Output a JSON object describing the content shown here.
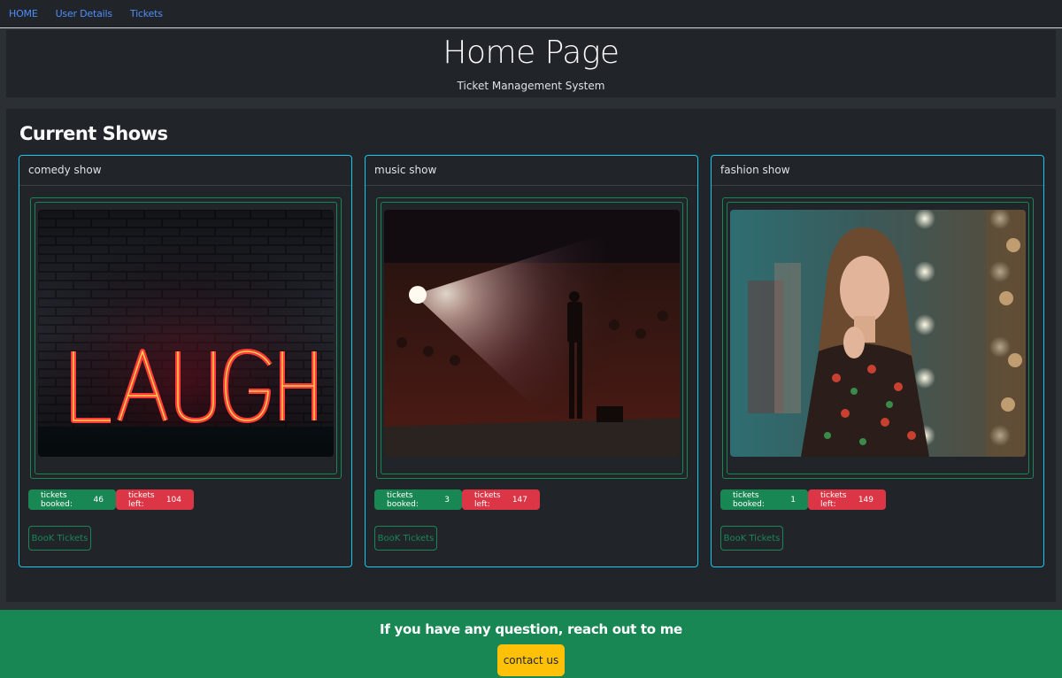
{
  "nav": {
    "items": [
      {
        "label": "HOME"
      },
      {
        "label": "User Details"
      },
      {
        "label": "Tickets"
      }
    ]
  },
  "header": {
    "title": "Home Page",
    "subtitle": "Ticket Management System"
  },
  "main": {
    "section_title": "Current Shows",
    "shows": [
      {
        "name": "comedy show",
        "booked_label": "tickets booked:",
        "booked": "46",
        "left_label": "tickets left:",
        "left": "104",
        "button": "BooK Tickets",
        "image": "laugh-neon-sign"
      },
      {
        "name": "music show",
        "booked_label": "tickets booked:",
        "booked": "3",
        "left_label": "tickets left:",
        "left": "147",
        "button": "BooK Tickets",
        "image": "concert-stage-spotlight"
      },
      {
        "name": "fashion show",
        "booked_label": "tickets booked:",
        "booked": "1",
        "left_label": "tickets left:",
        "left": "149",
        "button": "BooK Tickets",
        "image": "woman-portrait"
      }
    ]
  },
  "footer": {
    "text": "If you have any question, reach out to me",
    "button": "contact us"
  },
  "colors": {
    "background": "#2b3035",
    "panel": "#212529",
    "accent_info": "#0dcaf0",
    "success": "#198754",
    "danger": "#dc3545",
    "warning": "#ffc107",
    "link": "#4d8dfd"
  }
}
